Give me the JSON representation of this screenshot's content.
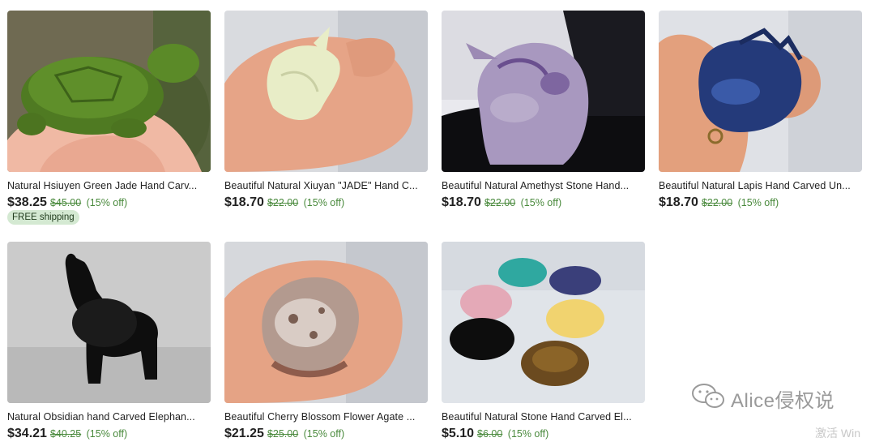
{
  "products": [
    {
      "title": "Natural Hsiuyen Green Jade Hand Carv...",
      "price": "$38.25",
      "original_price": "$45.00",
      "discount": "(15% off)",
      "badge": "FREE shipping",
      "image": "green-jade-turtle"
    },
    {
      "title": "Beautiful Natural Xiuyan \"JADE\" Hand C...",
      "price": "$18.70",
      "original_price": "$22.00",
      "discount": "(15% off)",
      "image": "xiuyan-jade-unicorn"
    },
    {
      "title": "Beautiful Natural Amethyst Stone Hand...",
      "price": "$18.70",
      "original_price": "$22.00",
      "discount": "(15% off)",
      "image": "amethyst-unicorn"
    },
    {
      "title": "Beautiful Natural Lapis Hand Carved Un...",
      "price": "$18.70",
      "original_price": "$22.00",
      "discount": "(15% off)",
      "image": "lapis-unicorn"
    },
    {
      "title": "Natural Obsidian hand Carved Elephan...",
      "price": "$34.21",
      "original_price": "$40.25",
      "discount": "(15% off)",
      "image": "obsidian-elephant"
    },
    {
      "title": "Beautiful Cherry Blossom Flower Agate ...",
      "price": "$21.25",
      "original_price": "$25.00",
      "discount": "(15% off)",
      "image": "cherry-blossom-agate-unicorn"
    },
    {
      "title": "Beautiful Natural Stone Hand Carved El...",
      "price": "$5.10",
      "original_price": "$6.00",
      "discount": "(15% off)",
      "image": "assorted-stone-elephants"
    }
  ],
  "watermark": {
    "text": "Alice侵权说",
    "icon": "wechat-icon"
  },
  "os_overlay": {
    "text": "激活 Win"
  },
  "colors": {
    "discount_green": "#4a8a3d",
    "free_shipping_bg": "#d4e9d2",
    "price_text": "#222222"
  }
}
